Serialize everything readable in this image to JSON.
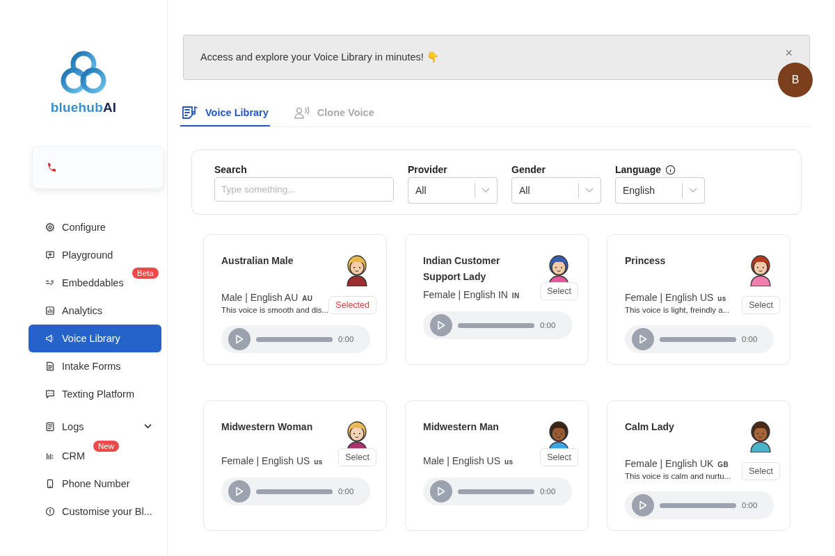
{
  "brand": {
    "name_part": "bluehub",
    "name_accent": "AI"
  },
  "sidebar": {
    "items": [
      {
        "label": "Configure",
        "selected": false
      },
      {
        "label": "Playground",
        "selected": false
      },
      {
        "label": "Embeddables",
        "selected": false,
        "badge": "Beta"
      },
      {
        "label": "Analytics",
        "selected": false
      },
      {
        "label": "Voice Library",
        "selected": true
      },
      {
        "label": "Intake Forms",
        "selected": false
      },
      {
        "label": "Texting Platform",
        "selected": false
      },
      {
        "label": "Logs",
        "selected": false,
        "expandable": true
      },
      {
        "label": "CRM",
        "selected": false,
        "badge": "New"
      },
      {
        "label": "Phone Number",
        "selected": false
      },
      {
        "label": "Customise your Bl...",
        "selected": false
      }
    ]
  },
  "banner": {
    "text": "Access and explore your Voice Library in minutes! 👇",
    "close": "×"
  },
  "user": {
    "initial": "B"
  },
  "tabs": [
    {
      "label": "Voice Library",
      "selected": true
    },
    {
      "label": "Clone Voice",
      "selected": false
    }
  ],
  "filters": [
    {
      "label": "Search",
      "kind": "text",
      "placeholder": "Type something..."
    },
    {
      "label": "Provider",
      "kind": "select",
      "value": "All"
    },
    {
      "label": "Gender",
      "kind": "select",
      "value": "All"
    },
    {
      "label": "Language",
      "kind": "select",
      "value": "English",
      "info": true
    }
  ],
  "voices": [
    {
      "name": "Australian Male",
      "meta": "Male | English AU",
      "code": "AU",
      "description": "This voice is smooth and dis...",
      "button": "Selected",
      "selected": true,
      "time": "0:00"
    },
    {
      "name": "Indian Customer Support Lady",
      "meta": "Female | English IN",
      "code": "IN",
      "button": "Select",
      "selected": false,
      "time": "0:00"
    },
    {
      "name": "Princess",
      "meta": "Female | English US",
      "code": "us",
      "description": "This voice is light, freindly a...",
      "button": "Select",
      "selected": false,
      "time": "0:00"
    },
    {
      "name": "Midwestern Woman",
      "meta": "Female | English US",
      "code": "us",
      "button": "Select",
      "selected": false,
      "time": "0:00"
    },
    {
      "name": "Midwestern Man",
      "meta": "Male | English US",
      "code": "us",
      "button": "Select",
      "selected": false,
      "time": "0:00"
    },
    {
      "name": "Calm Lady",
      "meta": "Female | English UK",
      "code": "GB",
      "description": "This voice is calm and nurtu...",
      "button": "Select",
      "selected": false,
      "time": "0:00"
    }
  ]
}
